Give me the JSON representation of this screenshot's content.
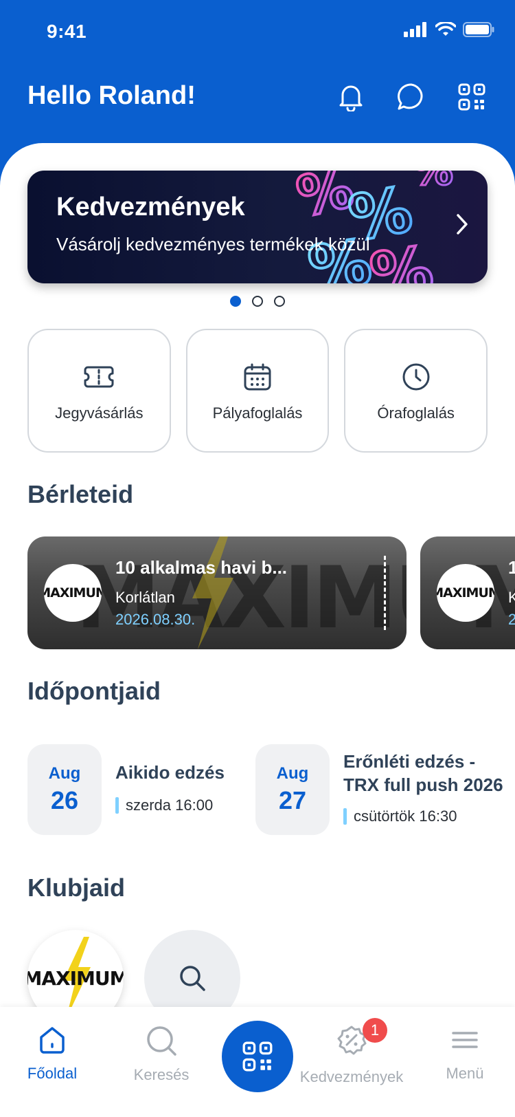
{
  "status_bar": {
    "time": "9:41"
  },
  "header": {
    "greeting": "Hello Roland!"
  },
  "banner": {
    "title": "Kedvezmények",
    "subtitle": "Vásárolj kedvezményes termékek közül",
    "pagination": {
      "total": 3,
      "active": 1
    }
  },
  "quick_actions": [
    {
      "label": "Jegyvásárlás",
      "icon": "ticket-icon"
    },
    {
      "label": "Pályafoglalás",
      "icon": "calendar-icon"
    },
    {
      "label": "Órafoglalás",
      "icon": "clock-icon"
    }
  ],
  "passes": {
    "title": "Bérleteid",
    "items": [
      {
        "name": "10 alkalmas havi b...",
        "type": "Korlátlan",
        "expiry": "2026.08.30.",
        "logo": "MAXIMUM"
      },
      {
        "name": "1",
        "type": "K",
        "expiry": "2",
        "logo": "MAXIMUM"
      }
    ]
  },
  "appointments": {
    "title": "Időpontjaid",
    "items": [
      {
        "month": "Aug",
        "day": "26",
        "title": "Aikido edzés",
        "time": "szerda 16:00"
      },
      {
        "month": "Aug",
        "day": "27",
        "title": "Erőnléti edzés - TRX full push 2026",
        "time": "csütörtök 16:30"
      }
    ]
  },
  "clubs": {
    "title": "Klubjaid",
    "logo": "MAXIMUM"
  },
  "tabbar": {
    "home": "Főoldal",
    "search": "Keresés",
    "discounts": "Kedvezmények",
    "discounts_badge": "1",
    "menu": "Menü"
  },
  "colors": {
    "primary": "#0a5fcf",
    "heading": "#2f4258",
    "accent_light": "#7fd0ff",
    "badge": "#f04c4c"
  }
}
